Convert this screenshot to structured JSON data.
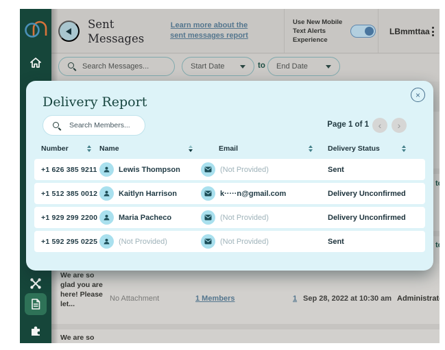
{
  "colors": {
    "sidebar_green": "#16463a",
    "active_item_green": "#2e7257",
    "modal_bg": "#ddf3f8",
    "accent_teal": "#45808a",
    "link_blue": "#54768e",
    "toggle_blue": "#49759e",
    "logo_orange": "#d9733a",
    "logo_blue": "#4a90b8"
  },
  "icons": {
    "close": "×",
    "chevron_left": "‹",
    "chevron_right": "›"
  },
  "sidebar": {
    "items": [
      {
        "icon": "home-icon"
      },
      {
        "icon": "network-icon"
      },
      {
        "icon": "document-icon",
        "active": true
      },
      {
        "icon": "puzzle-icon"
      }
    ]
  },
  "header": {
    "title": "Sent Messages",
    "link": "Learn more about the sent messages report",
    "toggle_label": "Use New Mobile Text Alerts Experience",
    "toggle_on": true,
    "username": "LBmmttaa"
  },
  "filters": {
    "search_placeholder": "Search Messages...",
    "start_date": "Start Date",
    "to": "to",
    "end_date": "End Date"
  },
  "modal": {
    "title": "Delivery Report",
    "search_placeholder": "Search Members...",
    "pagination": {
      "label": "Page 1 of 1"
    },
    "table": {
      "columns": [
        "Number",
        "Name",
        "Email",
        "Delivery Status"
      ],
      "rows": [
        {
          "number": "+1 626 385 9211",
          "name": "Lewis Thompson",
          "email": "(Not Provided)",
          "status": "Sent"
        },
        {
          "number": "+1 512 385 0012",
          "name": "Kaitlyn Harrison",
          "email": "k·····n@gmail.com",
          "status": "Delivery Unconfirmed"
        },
        {
          "number": "+1 929 299 2200",
          "name": "Maria Pacheco",
          "email": "(Not Provided)",
          "status": "Delivery Unconfirmed"
        },
        {
          "number": "+1 592 295 0225",
          "name": "(Not Provided)",
          "email": "(Not Provided)",
          "status": "Sent"
        }
      ]
    }
  },
  "background": {
    "row1": {
      "message": "We are so glad you are here! Please let...",
      "attachment": "No Attachment",
      "members_link": "1 Members",
      "count": "1",
      "date": "Sep 28, 2022 at 10:30 am",
      "sender": "Administrator"
    },
    "row2": {
      "message": "We are so"
    },
    "edge_fragment": "to"
  }
}
